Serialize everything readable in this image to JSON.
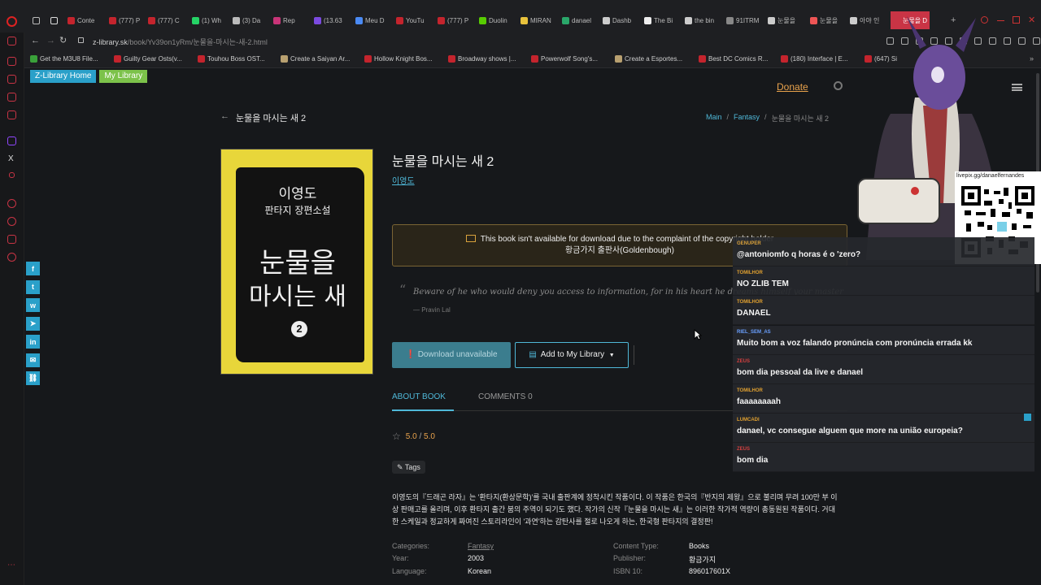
{
  "browser": {
    "tabs": [
      "Conte",
      "(777) P",
      "(777) C",
      "(1) Wh",
      "(3) Da",
      "Rep",
      "(13.63",
      "Meu D",
      "YouTu",
      "(777) P",
      "Duolin",
      "MIRAN",
      "danael",
      "Dashb",
      "The Bi",
      "the bin",
      "91ITRM",
      "눈물을",
      "눈물을",
      "아야 인",
      "눈물을 D"
    ],
    "url_host": "z-library.sk",
    "url_path": "/book/Yv39on1yRm/눈물을-마시는-새-2.html",
    "bookmarks": [
      "Get the M3U8 File...",
      "Guilty Gear Osts(v...",
      "Touhou Boss OST...",
      "Create a Saiyan Ar...",
      "Hollow Knight Bos...",
      "Broadway shows |...",
      "Powerwolf Song's...",
      "Create a Esportes...",
      "Best DC Comics R...",
      "(180) Interface | E...",
      "(647) Si"
    ]
  },
  "site": {
    "home_label": "Z-Library Home",
    "mylib_label": "My Library",
    "donate": "Donate",
    "back_title": "눈물을 마시는 새 2",
    "breadcrumb": [
      "Main",
      "Fantasy",
      "눈물을 마시는 새 2"
    ]
  },
  "book": {
    "title": "눈물을 마시는 새 2",
    "author": "이영도",
    "cover_author": "이영도",
    "cover_subtitle": "판타지 장편소설",
    "cover_title_1": "눈물을",
    "cover_title_2": "마시는 새",
    "cover_volume": "2",
    "notice_line1": "This book isn't available for download due to the complaint of the copyright holder",
    "notice_line2": "황금가지 출판사(Goldenbough)",
    "quote": "Beware of he who would deny you access to information, for in his heart he dreams himself your master",
    "quote_author": "— Pravin Lal",
    "download_label": "Download unavailable",
    "add_label": "Add to My Library",
    "tab_about": "ABOUT BOOK",
    "tab_comments": "COMMENTS 0",
    "rating": "5.0",
    "rating_max": "5.0",
    "tags_label": "Tags",
    "description": "이영도의『드래곤 라자』는 '환타지(환상문학)'를 국내 출판계에 정착시킨 작품이다. 이 작품은 한국의『반지의 제왕』으로 불리며 무려 100만 부 이상 판매고를 올리며, 이후 환타지 출간 붐의 주역이 되기도 했다. 작가의 신작『눈물을 마시는 새』는 이러한 작가적 역량이 총동원된 작품이다. 거대한 스케일과 정교하게 짜여진 스토리라인이 '과연'하는 감탄사를 절로 나오게 하는, 한국형 판타지의 결정판!",
    "meta": {
      "categories_k": "Categories:",
      "categories_v": "Fantasy",
      "year_k": "Year:",
      "year_v": "2003",
      "language_k": "Language:",
      "language_v": "Korean",
      "content_type_k": "Content Type:",
      "content_type_v": "Books",
      "publisher_k": "Publisher:",
      "publisher_v": "황금가지",
      "isbn_k": "ISBN 10:",
      "isbn_v": "896017601X"
    }
  },
  "stream": {
    "qr_label": "livepix.gg/danaelfernandes",
    "chat": [
      {
        "user": "GENUPER",
        "msg": "@antoniomfo q horas é o 'zero?",
        "color": "#d9a13b"
      },
      {
        "user": "TOMILHOR",
        "msg": "NO ZLIB TEM",
        "color": "#e0a030"
      },
      {
        "user": "TOMILHOR",
        "msg": "DANAEL",
        "color": "#e0a030"
      },
      {
        "user": "RIEL_SEM_AS",
        "msg": "Muito bom a voz falando pronúncia com pronúncia errada kk",
        "color": "#6aa0ff"
      },
      {
        "user": "ZEUS",
        "msg": "bom dia pessoal da live e danael",
        "color": "#d44040"
      },
      {
        "user": "TOMILHOR",
        "msg": "faaaaaaaah",
        "color": "#e0a030"
      },
      {
        "user": "LUMCADI",
        "msg": "danael, vc consegue alguem que more na união europeia?",
        "color": "#e0a030"
      },
      {
        "user": "ZEUS",
        "msg": "bom dia",
        "color": "#d44040"
      }
    ]
  },
  "colors": {
    "accent": "#4fb8d8",
    "donate": "#e8a24c",
    "home_tab": "#2aa0c9",
    "mylib_tab": "#7cc24a"
  }
}
